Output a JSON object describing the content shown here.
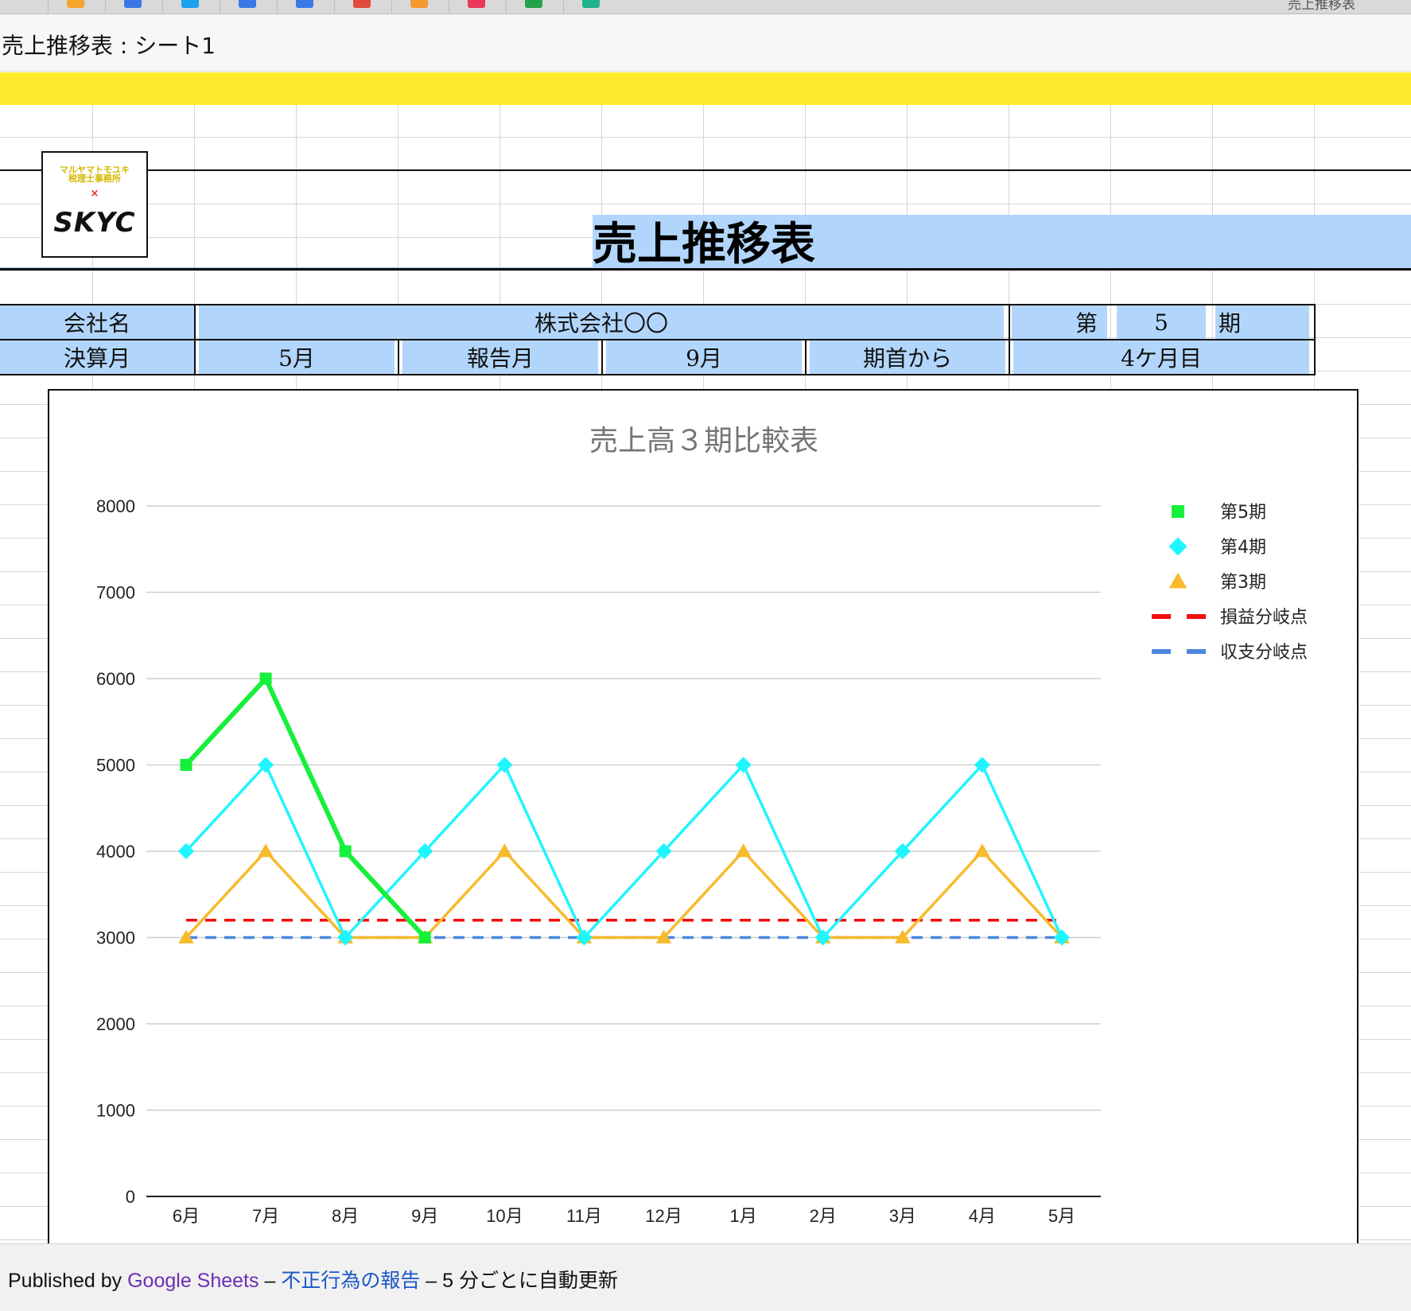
{
  "browser": {
    "window_title": "売上推移表",
    "bookmark_colors": [
      "#f4a52e",
      "#3b78e7",
      "#1da1f2",
      "#3b78e7",
      "#3b78e7",
      "#e04a3c",
      "#f49b2d",
      "#e8395a",
      "#22a24a",
      "#21b38a"
    ]
  },
  "document": {
    "title": "売上推移表 : シート1"
  },
  "logo": {
    "top_text": "マルヤマトモユキ\n税理士事務所",
    "x_mark": "×",
    "main_text": "SKYC"
  },
  "sheet": {
    "title": "売上推移表",
    "company_label": "会社名",
    "company_value": "株式会社〇〇",
    "period_prefix": "第",
    "period_value": "5",
    "period_suffix": "期",
    "fiscal_month_label": "決算月",
    "fiscal_month_value": "5月",
    "report_month_label": "報告月",
    "report_month_value": "9月",
    "elapsed_label": "期首から",
    "elapsed_value": "4ケ月目"
  },
  "chart_data": {
    "type": "line",
    "title": "売上高３期比較表",
    "categories": [
      "6月",
      "7月",
      "8月",
      "9月",
      "10月",
      "11月",
      "12月",
      "1月",
      "2月",
      "3月",
      "4月",
      "5月"
    ],
    "ylim": [
      0,
      8000
    ],
    "yticks": [
      0,
      1000,
      2000,
      3000,
      4000,
      5000,
      6000,
      7000,
      8000
    ],
    "grid": true,
    "legend_position": "right",
    "series": [
      {
        "name": "第5期",
        "color": "#16f03a",
        "marker": "square",
        "style": "solid",
        "values": [
          5000,
          6000,
          4000,
          3000,
          null,
          null,
          null,
          null,
          null,
          null,
          null,
          null
        ]
      },
      {
        "name": "第4期",
        "color": "#1ff5ff",
        "marker": "diamond",
        "style": "solid",
        "values": [
          4000,
          5000,
          3000,
          4000,
          5000,
          3000,
          4000,
          5000,
          3000,
          4000,
          5000,
          3000
        ]
      },
      {
        "name": "第3期",
        "color": "#f7ba2b",
        "marker": "triangle",
        "style": "solid",
        "values": [
          3000,
          4000,
          3000,
          3000,
          4000,
          3000,
          3000,
          4000,
          3000,
          3000,
          4000,
          3000
        ]
      },
      {
        "name": "損益分岐点",
        "color": "#f20d0d",
        "marker": "none",
        "style": "dashed",
        "values": [
          3200,
          3200,
          3200,
          3200,
          3200,
          3200,
          3200,
          3200,
          3200,
          3200,
          3200,
          3200
        ]
      },
      {
        "name": "収支分岐点",
        "color": "#4a86e0",
        "marker": "none",
        "style": "dashed",
        "values": [
          3000,
          3000,
          3000,
          3000,
          3000,
          3000,
          3000,
          3000,
          3000,
          3000,
          3000,
          3000
        ]
      }
    ]
  },
  "footer": {
    "published_by": "Published by ",
    "google_sheets_link": "Google Sheets",
    "sep1": " – ",
    "report_abuse_link": "不正行為の報告",
    "sep2": " – ",
    "auto_update": "5 分ごとに自動更新",
    "link_colors": {
      "google_sheets": "#6b2fb3",
      "report": "#1a57c9"
    }
  }
}
